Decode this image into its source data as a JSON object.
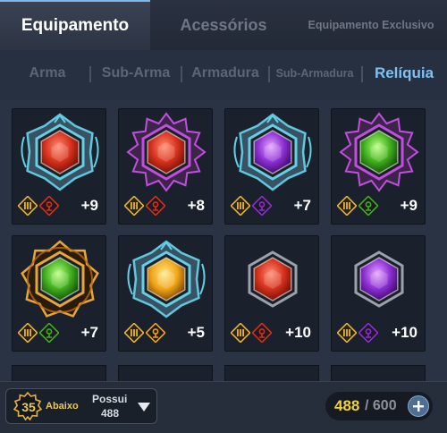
{
  "tabs": [
    "Equipamento",
    "Acessórios",
    "Equipamento Exclusivo"
  ],
  "subtabs": [
    "Arma",
    "Sub-Arma",
    "Armadura",
    "Sub-Armadura",
    "Relíquia"
  ],
  "items": [
    {
      "gem": "red",
      "frame": "cyan",
      "stat": "red",
      "level": "+9"
    },
    {
      "gem": "red",
      "frame": "purple",
      "stat": "red",
      "level": "+8"
    },
    {
      "gem": "purple",
      "frame": "cyan",
      "stat": "purple",
      "level": "+7"
    },
    {
      "gem": "green",
      "frame": "purple",
      "stat": "green",
      "level": "+9"
    },
    {
      "gem": "green",
      "frame": "gold",
      "stat": "green",
      "level": "+7"
    },
    {
      "gem": "yellow",
      "frame": "cyan",
      "stat": "yellow",
      "level": "+5"
    },
    {
      "gem": "red",
      "frame": "none",
      "stat": "red",
      "level": "+10"
    },
    {
      "gem": "purple",
      "frame": "none",
      "stat": "purple",
      "level": "+10"
    }
  ],
  "filter": {
    "level": "35",
    "label": "Abaixo",
    "possess_label": "Possui",
    "possess_count": "488",
    "icon": "chevron-down-icon"
  },
  "inventory": {
    "current": "488",
    "max": "/ 600",
    "icon": "plus-icon"
  }
}
